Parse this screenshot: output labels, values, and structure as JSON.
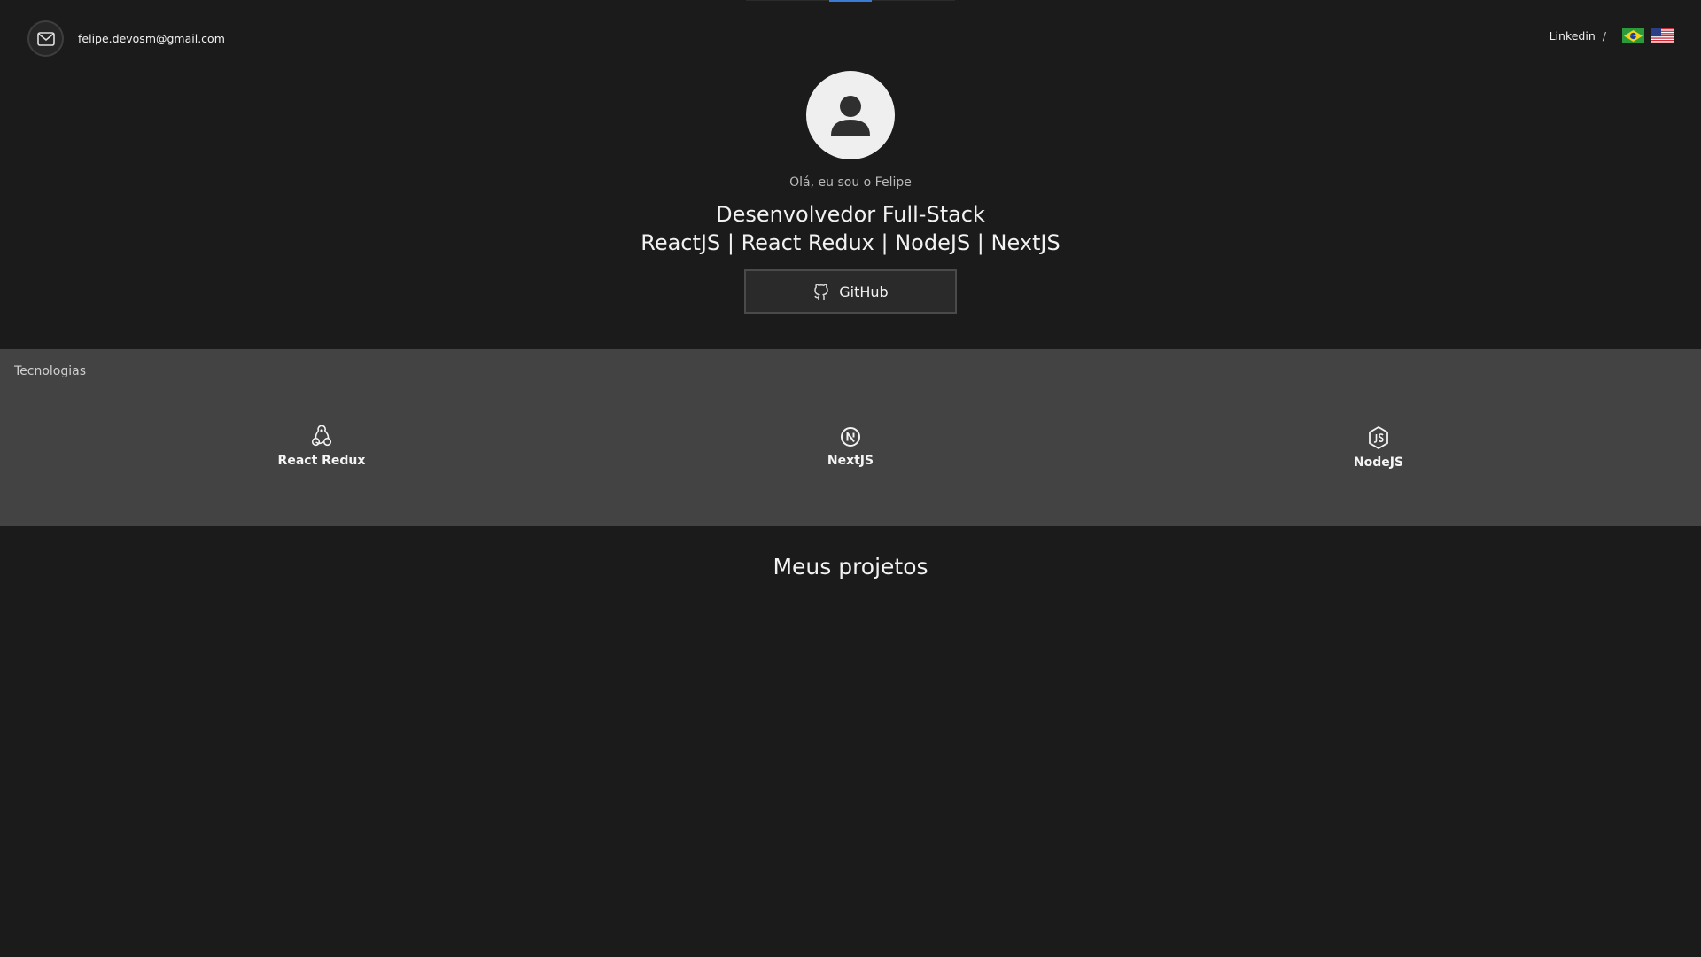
{
  "header": {
    "email": "felipe.devosm@gmail.com",
    "mail_icon": "mail-icon",
    "linkedin_label": "Linkedin",
    "separator": "/",
    "flags": [
      "brazil-flag",
      "usa-flag"
    ]
  },
  "hero": {
    "avatar_icon": "user-icon",
    "greeting": "Olá, eu sou o Felipe",
    "role": "Desenvolvedor Full-Stack",
    "stack": "ReactJS | React Redux | NodeJS | NextJS",
    "github_button": "GitHub"
  },
  "technologies": {
    "title": "Tecnologias",
    "items": [
      {
        "label": "React Redux",
        "icon": "redux-icon"
      },
      {
        "label": "NextJS",
        "icon": "nextjs-icon"
      },
      {
        "label": "NodeJS",
        "icon": "nodejs-icon"
      }
    ]
  },
  "projects": {
    "title": "Meus projetos"
  },
  "colors": {
    "background": "#1b1b1b",
    "tech_band": "#434343",
    "accent": "#3a7bd5"
  }
}
